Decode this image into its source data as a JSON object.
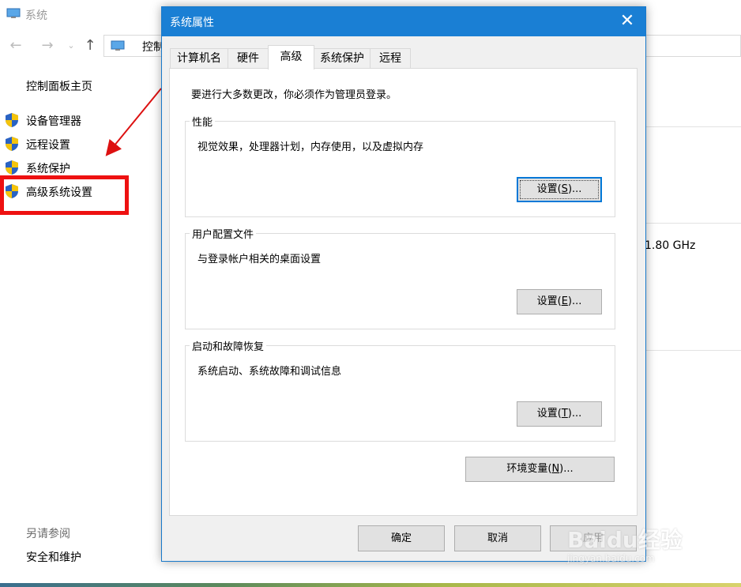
{
  "background_window": {
    "title": "系统",
    "address_text": "控制",
    "control_panel_home": "控制面板主页",
    "side_links": [
      {
        "label": "设备管理器"
      },
      {
        "label": "远程设置"
      },
      {
        "label": "系统保护"
      },
      {
        "label": "高级系统设置"
      }
    ],
    "see_also": "另请参阅",
    "security_link": "安全和维护",
    "cpu_speed": "1.80 GHz"
  },
  "dialog": {
    "title": "系统属性",
    "tabs": [
      {
        "label": "计算机名"
      },
      {
        "label": "硬件"
      },
      {
        "label": "高级"
      },
      {
        "label": "系统保护"
      },
      {
        "label": "远程"
      }
    ],
    "active_tab": "高级",
    "admin_note": "要进行大多数更改，你必须作为管理员登录。",
    "performance": {
      "title": "性能",
      "description": "视觉效果，处理器计划，内存使用，以及虚拟内存",
      "button_text": "设置(",
      "button_key": "S",
      "button_suffix": ")..."
    },
    "user_profiles": {
      "title": "用户配置文件",
      "description": "与登录帐户相关的桌面设置",
      "button_text": "设置(",
      "button_key": "E",
      "button_suffix": ")..."
    },
    "startup_recovery": {
      "title": "启动和故障恢复",
      "description": "系统启动、系统故障和调试信息",
      "button_text": "设置(",
      "button_key": "T",
      "button_suffix": ")..."
    },
    "env_button": {
      "text": "环境变量(",
      "key": "N",
      "suffix": ")..."
    },
    "ok_label": "确定",
    "cancel_label": "取消",
    "apply_label": "应用"
  },
  "watermark": {
    "text": "Baidu经验",
    "sub": "jingyan.baidu.com"
  },
  "colors": {
    "titlebar": "#1a7fd4",
    "highlight": "#ee1111",
    "arrow": "#dd1111"
  }
}
